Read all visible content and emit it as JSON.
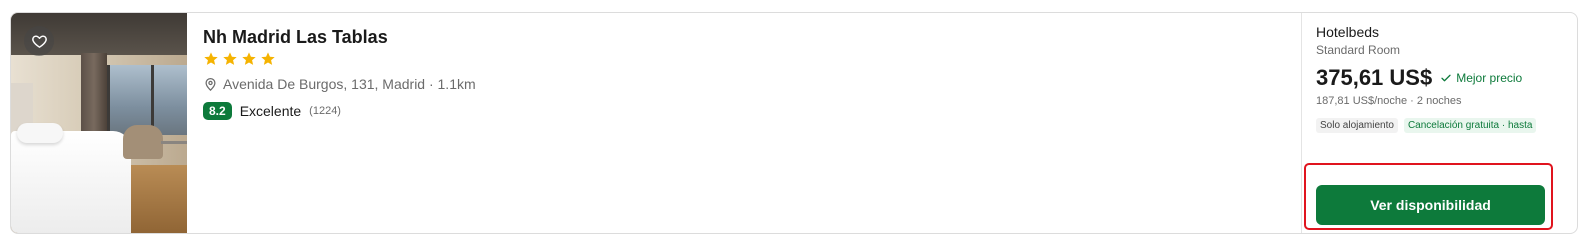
{
  "hotel": {
    "name": "Nh Madrid Las Tablas",
    "stars": 4,
    "address": "Avenida De Burgos, 131, Madrid · 1.1km",
    "rating": {
      "score": "8.2",
      "label": "Excelente",
      "count": "(1224)"
    }
  },
  "offer": {
    "provider": "Hotelbeds",
    "room_type": "Standard Room",
    "price": "375,61 US$",
    "best_price_label": "Mejor precio",
    "per_night": "187,81 US$/noche · 2 noches",
    "tags": [
      "Solo alojamiento",
      "Cancelación gratuita · hasta"
    ],
    "cta_label": "Ver disponibilidad"
  },
  "icons": {
    "favorite": "heart-icon",
    "star": "star-icon",
    "location": "location-pin-icon",
    "check": "check-icon"
  },
  "colors": {
    "accent_green": "#0d7a3b",
    "star": "#f5b301",
    "highlight_frame": "#e0141e"
  }
}
